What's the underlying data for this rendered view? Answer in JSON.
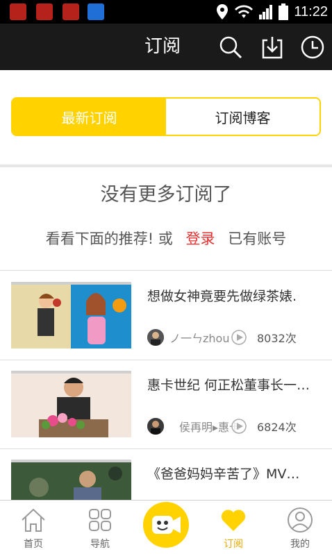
{
  "status_bar": {
    "time": "11:22"
  },
  "header": {
    "title": "订阅"
  },
  "tabs": [
    {
      "label": "最新订阅",
      "active": true
    },
    {
      "label": "订阅博客",
      "active": false
    }
  ],
  "empty_state": {
    "title": "没有更多订阅了",
    "prompt_before": "看看下面的推荐! 或",
    "login_link": "登录",
    "prompt_after": "已有账号"
  },
  "recommendations": [
    {
      "title": "想做女神竟要先做绿茶婊.",
      "author": "ノ一ㄣzhou",
      "views": "8032次"
    },
    {
      "title": "惠卡世纪 何正松董事长一…",
      "author": "侯再明▸惠卡",
      "views": "6824次"
    },
    {
      "title": "《爸爸妈妈辛苦了》MV…",
      "author": "",
      "views": ""
    }
  ],
  "bottom_nav": [
    {
      "label": "首页",
      "icon": "home-icon"
    },
    {
      "label": "导航",
      "icon": "grid-icon"
    },
    {
      "label": "",
      "icon": "camera-face-icon"
    },
    {
      "label": "订阅",
      "icon": "heart-icon",
      "active": true
    },
    {
      "label": "我的",
      "icon": "user-icon"
    }
  ],
  "colors": {
    "accent": "#ffd200",
    "login_link": "#e53030",
    "header_bg": "#1a1a1a"
  }
}
